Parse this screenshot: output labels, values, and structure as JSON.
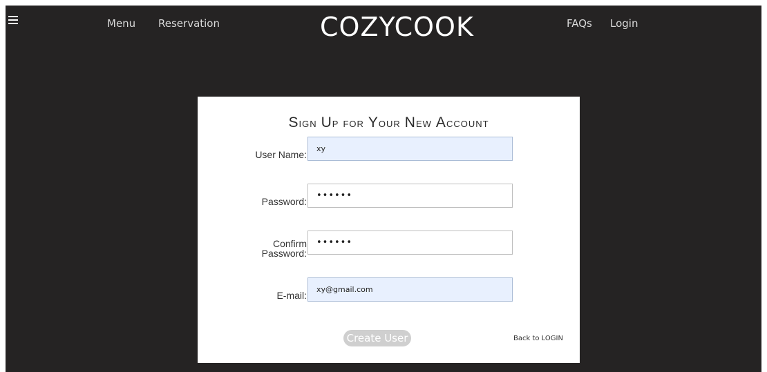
{
  "header": {
    "menu_icon": "hamburger-icon",
    "nav_left": [
      "Menu",
      "Reservation"
    ],
    "brand": "COZYCOOK",
    "nav_right": [
      "FAQs",
      "Login"
    ]
  },
  "form": {
    "title": "Sign Up for Your New Account",
    "title_parts": [
      {
        "cap": "S",
        "rest": "ign "
      },
      {
        "cap": "U",
        "rest": "p for "
      },
      {
        "cap": "Y",
        "rest": "our "
      },
      {
        "cap": "N",
        "rest": "ew "
      },
      {
        "cap": "A",
        "rest": "ccount"
      }
    ],
    "fields": [
      {
        "label": "User Name:",
        "value": "xy",
        "type": "text"
      },
      {
        "label": "Password:",
        "value": "••••••",
        "type": "password"
      },
      {
        "label_line1": "Confirm",
        "label_line2": "Password:",
        "value": "••••••",
        "type": "password"
      },
      {
        "label": "E-mail:",
        "value": "xy@gmail.com",
        "type": "email"
      }
    ],
    "submit_label": "Create User",
    "back_link": "Back to LOGIN"
  },
  "colors": {
    "page_bg": "#252323",
    "card_bg": "#ffffff",
    "autofill_bg": "#e8f0fe",
    "button_bg": "#cfcfcf"
  }
}
